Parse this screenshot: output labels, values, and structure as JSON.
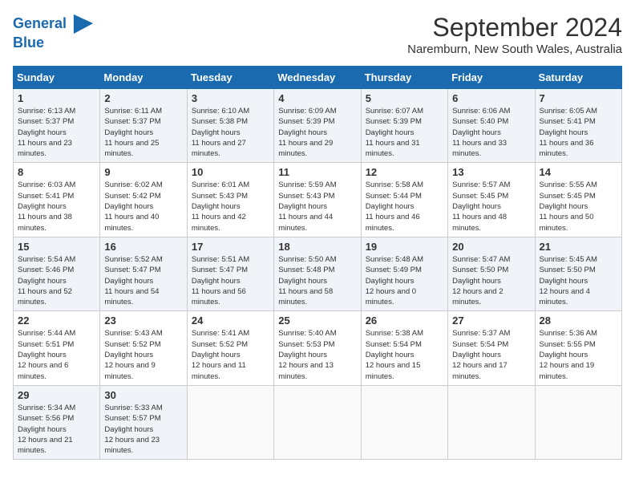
{
  "header": {
    "logo_line1": "General",
    "logo_line2": "Blue",
    "month_year": "September 2024",
    "location": "Naremburn, New South Wales, Australia"
  },
  "weekdays": [
    "Sunday",
    "Monday",
    "Tuesday",
    "Wednesday",
    "Thursday",
    "Friday",
    "Saturday"
  ],
  "weeks": [
    [
      {
        "day": "1",
        "sunrise": "6:13 AM",
        "sunset": "5:37 PM",
        "daylight": "11 hours and 23 minutes."
      },
      {
        "day": "2",
        "sunrise": "6:11 AM",
        "sunset": "5:37 PM",
        "daylight": "11 hours and 25 minutes."
      },
      {
        "day": "3",
        "sunrise": "6:10 AM",
        "sunset": "5:38 PM",
        "daylight": "11 hours and 27 minutes."
      },
      {
        "day": "4",
        "sunrise": "6:09 AM",
        "sunset": "5:39 PM",
        "daylight": "11 hours and 29 minutes."
      },
      {
        "day": "5",
        "sunrise": "6:07 AM",
        "sunset": "5:39 PM",
        "daylight": "11 hours and 31 minutes."
      },
      {
        "day": "6",
        "sunrise": "6:06 AM",
        "sunset": "5:40 PM",
        "daylight": "11 hours and 33 minutes."
      },
      {
        "day": "7",
        "sunrise": "6:05 AM",
        "sunset": "5:41 PM",
        "daylight": "11 hours and 36 minutes."
      }
    ],
    [
      {
        "day": "8",
        "sunrise": "6:03 AM",
        "sunset": "5:41 PM",
        "daylight": "11 hours and 38 minutes."
      },
      {
        "day": "9",
        "sunrise": "6:02 AM",
        "sunset": "5:42 PM",
        "daylight": "11 hours and 40 minutes."
      },
      {
        "day": "10",
        "sunrise": "6:01 AM",
        "sunset": "5:43 PM",
        "daylight": "11 hours and 42 minutes."
      },
      {
        "day": "11",
        "sunrise": "5:59 AM",
        "sunset": "5:43 PM",
        "daylight": "11 hours and 44 minutes."
      },
      {
        "day": "12",
        "sunrise": "5:58 AM",
        "sunset": "5:44 PM",
        "daylight": "11 hours and 46 minutes."
      },
      {
        "day": "13",
        "sunrise": "5:57 AM",
        "sunset": "5:45 PM",
        "daylight": "11 hours and 48 minutes."
      },
      {
        "day": "14",
        "sunrise": "5:55 AM",
        "sunset": "5:45 PM",
        "daylight": "11 hours and 50 minutes."
      }
    ],
    [
      {
        "day": "15",
        "sunrise": "5:54 AM",
        "sunset": "5:46 PM",
        "daylight": "11 hours and 52 minutes."
      },
      {
        "day": "16",
        "sunrise": "5:52 AM",
        "sunset": "5:47 PM",
        "daylight": "11 hours and 54 minutes."
      },
      {
        "day": "17",
        "sunrise": "5:51 AM",
        "sunset": "5:47 PM",
        "daylight": "11 hours and 56 minutes."
      },
      {
        "day": "18",
        "sunrise": "5:50 AM",
        "sunset": "5:48 PM",
        "daylight": "11 hours and 58 minutes."
      },
      {
        "day": "19",
        "sunrise": "5:48 AM",
        "sunset": "5:49 PM",
        "daylight": "12 hours and 0 minutes."
      },
      {
        "day": "20",
        "sunrise": "5:47 AM",
        "sunset": "5:50 PM",
        "daylight": "12 hours and 2 minutes."
      },
      {
        "day": "21",
        "sunrise": "5:45 AM",
        "sunset": "5:50 PM",
        "daylight": "12 hours and 4 minutes."
      }
    ],
    [
      {
        "day": "22",
        "sunrise": "5:44 AM",
        "sunset": "5:51 PM",
        "daylight": "12 hours and 6 minutes."
      },
      {
        "day": "23",
        "sunrise": "5:43 AM",
        "sunset": "5:52 PM",
        "daylight": "12 hours and 9 minutes."
      },
      {
        "day": "24",
        "sunrise": "5:41 AM",
        "sunset": "5:52 PM",
        "daylight": "12 hours and 11 minutes."
      },
      {
        "day": "25",
        "sunrise": "5:40 AM",
        "sunset": "5:53 PM",
        "daylight": "12 hours and 13 minutes."
      },
      {
        "day": "26",
        "sunrise": "5:38 AM",
        "sunset": "5:54 PM",
        "daylight": "12 hours and 15 minutes."
      },
      {
        "day": "27",
        "sunrise": "5:37 AM",
        "sunset": "5:54 PM",
        "daylight": "12 hours and 17 minutes."
      },
      {
        "day": "28",
        "sunrise": "5:36 AM",
        "sunset": "5:55 PM",
        "daylight": "12 hours and 19 minutes."
      }
    ],
    [
      {
        "day": "29",
        "sunrise": "5:34 AM",
        "sunset": "5:56 PM",
        "daylight": "12 hours and 21 minutes."
      },
      {
        "day": "30",
        "sunrise": "5:33 AM",
        "sunset": "5:57 PM",
        "daylight": "12 hours and 23 minutes."
      },
      null,
      null,
      null,
      null,
      null
    ]
  ]
}
